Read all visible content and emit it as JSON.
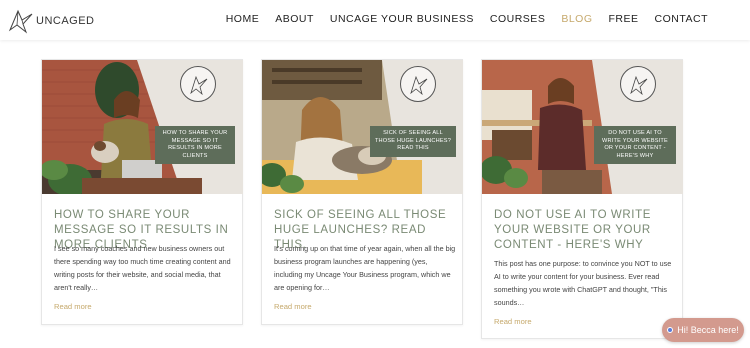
{
  "brand": {
    "name": "UNCAGED"
  },
  "nav": [
    {
      "label": "HOME"
    },
    {
      "label": "ABOUT"
    },
    {
      "label": "UNCAGE YOUR BUSINESS"
    },
    {
      "label": "COURSES"
    },
    {
      "label": "BLOG"
    },
    {
      "label": "FREE"
    },
    {
      "label": "CONTACT"
    }
  ],
  "active_nav": "BLOG",
  "posts": [
    {
      "title": "HOW TO SHARE YOUR MESSAGE SO IT RESULTS IN MORE CLIENTS",
      "badge": "HOW TO SHARE YOUR MESSAGE SO IT RESULTS IN MORE CLIENTS",
      "excerpt": "I see so many coaches and new business owners out there spending way too much time creating content and writing posts for their website, and social media, that aren't really…",
      "more": "Read more"
    },
    {
      "title": "SICK OF SEEING ALL THOSE HUGE LAUNCHES? READ THIS.",
      "badge": "SICK OF SEEING ALL THOSE HUGE LAUNCHES? READ THIS",
      "excerpt": "It's coming up on that time of year again, when all the big business program launches are happening (yes, including my Uncage Your Business program, which we are opening for…",
      "more": "Read more"
    },
    {
      "title": "DO NOT USE AI TO WRITE YOUR WEBSITE OR YOUR CONTENT - HERE'S WHY",
      "badge": "DO NOT USE AI TO WRITE YOUR WEBSITE OR YOUR CONTENT - HERE'S WHY",
      "excerpt": "This post has one purpose: to convince you NOT to use AI to write your content for your business.  Ever read something you wrote with ChatGPT and thought, \"This sounds…",
      "more": "Read more"
    }
  ],
  "chat": {
    "label": "Hi! Becca here!"
  },
  "colors": {
    "accent": "#c6a96c",
    "title": "#7a8a74",
    "badge": "#5e6d5a",
    "chat": "#d39a8e"
  }
}
